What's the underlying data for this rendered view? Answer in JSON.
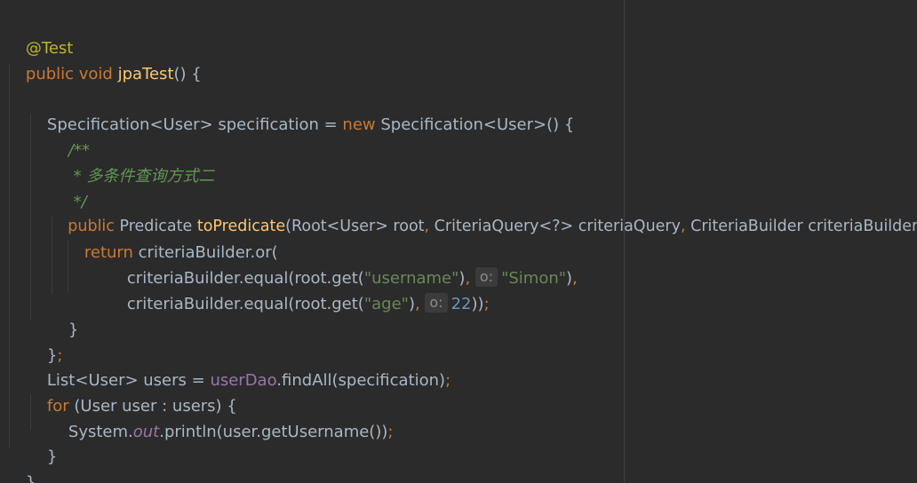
{
  "code": {
    "l1": {
      "annotation": "@Test"
    },
    "l2": {
      "kw": "public void ",
      "method": "jpaTest",
      "rest": "() {"
    },
    "l4": {
      "a": "Specification<User> specification = ",
      "kw": "new ",
      "b": "Specification<User>() {"
    },
    "l5": {
      "comment": "/**"
    },
    "l6": {
      "star": " * ",
      "text": "多条件查询方式二"
    },
    "l7": {
      "comment": " */"
    },
    "l8": {
      "kw": "public ",
      "a": "Predicate ",
      "method": "toPredicate",
      "b": "(Root<User> root",
      "c1": ", ",
      "d": "CriteriaQuery<?> criteriaQuery",
      "c2": ", ",
      "e": "CriteriaBuilder criteriaBuilder) {"
    },
    "l9": {
      "kw": "return ",
      "rest": "criteriaBuilder.or("
    },
    "l10": {
      "a": "criteriaBuilder.equal(root.get(",
      "str": "\"username\"",
      "b": ")",
      "comma": ", ",
      "hint": "o:",
      "str2": "\"Simon\"",
      "c": ")",
      "comma2": ","
    },
    "l11": {
      "a": "criteriaBuilder.equal(root.get(",
      "str": "\"age\"",
      "b": ")",
      "comma": ", ",
      "hint": "o:",
      "num": "22",
      "c": "))",
      "semi": ";"
    },
    "l12": {
      "rest": "}"
    },
    "l13": {
      "a": "}",
      "semi": ";"
    },
    "l14": {
      "a": "List<User> users = ",
      "field": "userDao",
      "b": ".findAll(specification)",
      "semi": ";"
    },
    "l15": {
      "kw": "for ",
      "rest": "(User user : users) {"
    },
    "l16": {
      "a": "System.",
      "static": "out",
      "b": ".println(user.getUsername())",
      "semi": ";"
    },
    "l17": {
      "rest": "}"
    },
    "l18": {
      "rest": "}"
    }
  }
}
